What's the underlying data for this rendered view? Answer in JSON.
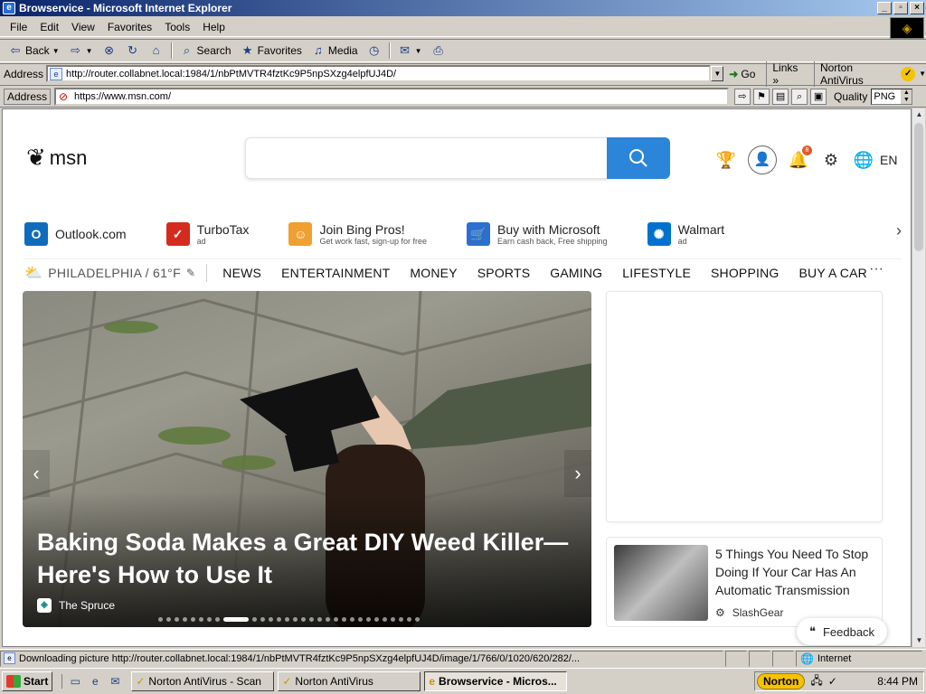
{
  "window": {
    "title": "Browservice - Microsoft Internet Explorer",
    "buttons": [
      "_",
      "▫",
      "×"
    ]
  },
  "menu": [
    "File",
    "Edit",
    "View",
    "Favorites",
    "Tools",
    "Help"
  ],
  "toolbar": {
    "back": "Back",
    "search": "Search",
    "favorites": "Favorites",
    "media": "Media"
  },
  "ie_address": {
    "label": "Address",
    "url": "http://router.collabnet.local:1984/1/nbPtMVTR4fztKc9P5npSXzg4elpfUJ4D/",
    "go": "Go",
    "links": "Links",
    "norton": "Norton AntiVirus"
  },
  "bs_bar": {
    "label": "Address",
    "url": "https://www.msn.com/",
    "quality_label": "Quality",
    "quality_value": "PNG"
  },
  "msn": {
    "logo": "msn",
    "lang": "EN",
    "notification_count": "8",
    "shortcuts": [
      {
        "name": "Outlook.com",
        "sub": "",
        "color": "#0f6cbd",
        "glyph": "O"
      },
      {
        "name": "TurboTax",
        "sub": "ad",
        "color": "#d52b1e",
        "glyph": "✓"
      },
      {
        "name": "Join Bing Pros!",
        "sub": "Get work fast, sign-up for free",
        "color": "#f0a030",
        "glyph": "☺"
      },
      {
        "name": "Buy with Microsoft",
        "sub": "Earn cash back, Free shipping",
        "color": "#2b6fd1",
        "glyph": "🛒"
      },
      {
        "name": "Walmart",
        "sub": "ad",
        "color": "#0071ce",
        "glyph": "✺"
      }
    ],
    "weather": "PHILADELPHIA / 61°F",
    "nav": [
      "NEWS",
      "ENTERTAINMENT",
      "MONEY",
      "SPORTS",
      "GAMING",
      "LIFESTYLE",
      "SHOPPING",
      "BUY A CAR"
    ],
    "hero": {
      "title": "Baking Soda Makes a Great DIY Weed Killer—Here's How to Use It",
      "source": "The Spruce",
      "slides": 30,
      "active_slide": 8
    },
    "news": {
      "title": "5 Things You Need To Stop Doing If Your Car Has An Automatic Transmission",
      "source": "SlashGear"
    },
    "feedback": "Feedback"
  },
  "status": {
    "text": "Downloading picture http://router.collabnet.local:1984/1/nbPtMVTR4fztKc9P5npSXzg4elpfUJ4D/image/1/766/0/1020/620/282/...",
    "zone": "Internet"
  },
  "taskbar": {
    "start": "Start",
    "tasks": [
      {
        "label": "Norton AntiVirus - Scan",
        "active": false
      },
      {
        "label": "Norton AntiVirus",
        "active": false
      },
      {
        "label": "Browservice - Micros...",
        "active": true
      }
    ],
    "norton": "Norton",
    "clock": "8:44 PM"
  }
}
